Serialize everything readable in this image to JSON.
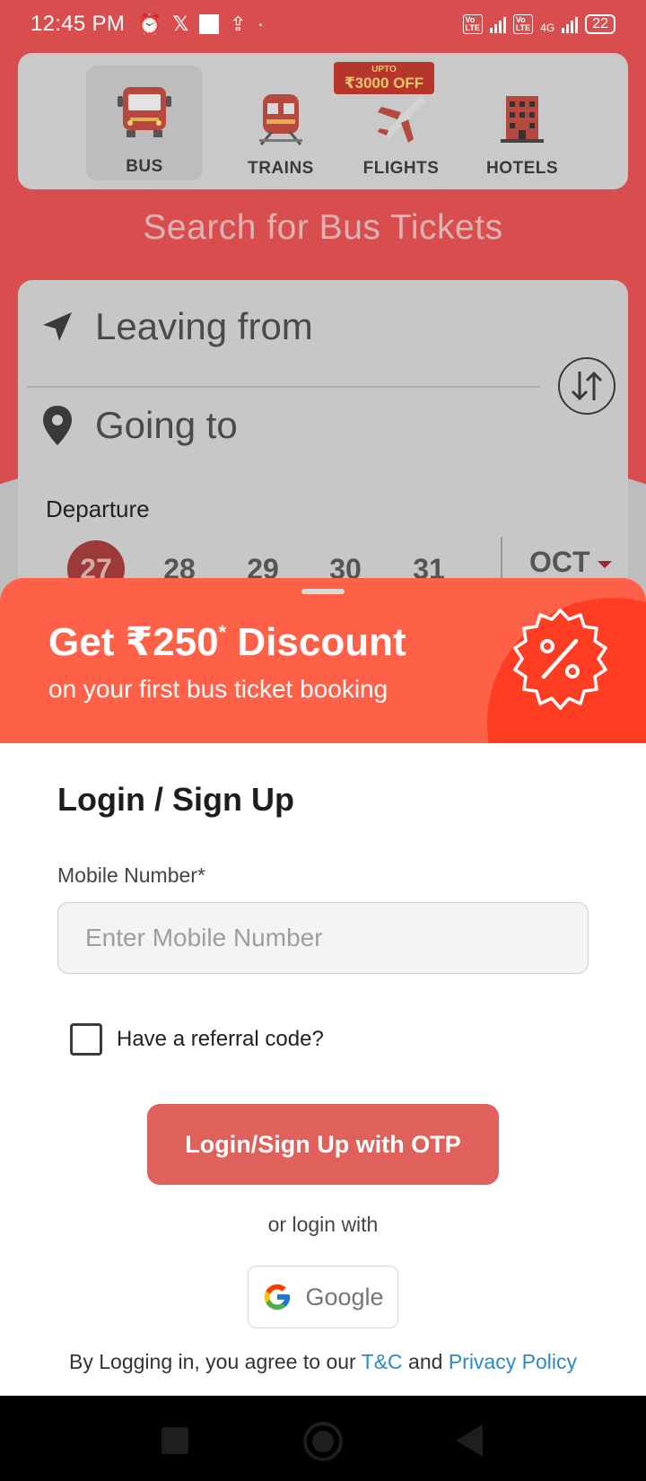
{
  "status_bar": {
    "time": "12:45 PM",
    "network": "4G",
    "battery": "22"
  },
  "services": [
    {
      "label": "BUS",
      "icon": "bus-icon",
      "selected": true
    },
    {
      "label": "TRAINS",
      "icon": "train-icon",
      "selected": false
    },
    {
      "label": "FLIGHTS",
      "icon": "airplane-icon",
      "selected": false
    },
    {
      "label": "HOTELS",
      "icon": "hotel-icon",
      "selected": false
    }
  ],
  "offer_badge": {
    "top": "UPTO",
    "amount": "₹3000 OFF"
  },
  "search": {
    "title": "Search for Bus Tickets",
    "leaving_from": "Leaving from",
    "going_to": "Going to",
    "departure_label": "Departure",
    "dates": [
      "27",
      "28",
      "29",
      "30",
      "31"
    ],
    "selected_date": "27",
    "month": "OCT"
  },
  "promo": {
    "title": "Get ₹250",
    "title_sup": "*",
    "title_tail": " Discount",
    "subtitle": "on your first bus ticket booking"
  },
  "login": {
    "title": "Login / Sign Up",
    "mobile_label": "Mobile Number*",
    "mobile_placeholder": "Enter Mobile Number",
    "mobile_value": "",
    "referral_label": "Have a referral code?",
    "referral_checked": false,
    "otp_button": "Login/Sign Up with OTP",
    "or_text": "or login with",
    "google_label": "Google",
    "terms_prefix": "By Logging in, you agree to our ",
    "terms_link": "T&C",
    "terms_mid": " and ",
    "privacy_link": "Privacy Policy"
  },
  "colors": {
    "brand_red": "#d84e4e",
    "promo_orange": "#ff6148",
    "otp_button": "#de615c",
    "link_blue": "#2b8cc4"
  }
}
